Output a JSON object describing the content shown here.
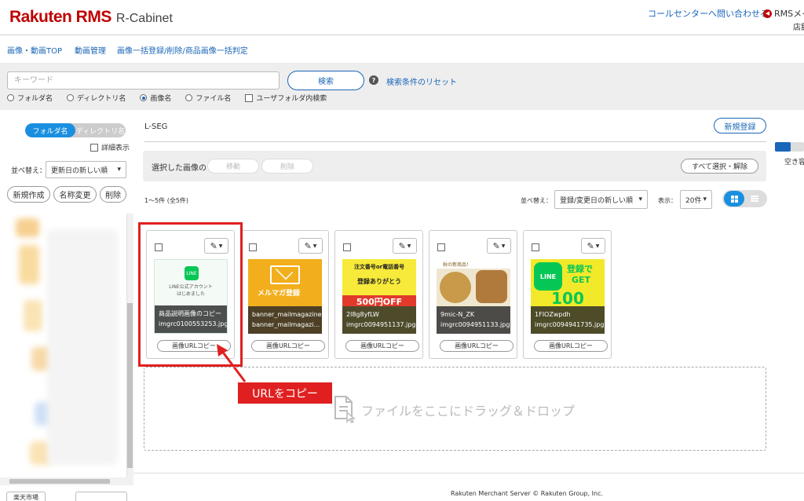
{
  "header": {
    "brand": "Rakuten RMS",
    "product": "R-Cabinet",
    "callcenter_link": "コールセンターへ問い合わせる",
    "rms_link": "RMSメイ",
    "store_label": "店舗"
  },
  "nav": [
    "画像・動画TOP",
    "動画管理",
    "画像一括登録/削除/商品画像一括判定"
  ],
  "search": {
    "placeholder": "キーワード",
    "button": "検索",
    "reset": "検索条件のリセット",
    "options": [
      {
        "label": "フォルダ名",
        "type": "radio",
        "checked": false
      },
      {
        "label": "ディレクトリ名",
        "type": "radio",
        "checked": false
      },
      {
        "label": "画像名",
        "type": "radio",
        "checked": true
      },
      {
        "label": "ファイル名",
        "type": "radio",
        "checked": false
      },
      {
        "label": "ユーザフォルダ内検索",
        "type": "checkbox",
        "checked": false
      }
    ]
  },
  "sidebar": {
    "toggle": [
      "フォルダ名",
      "ディレクトリ名"
    ],
    "detail": "詳細表示",
    "sort_label": "並べ替え：",
    "sort_value": "更新日の新しい順",
    "buttons": [
      "新規作成",
      "名称変更",
      "削除"
    ],
    "bottom": [
      "楽天市場",
      ""
    ]
  },
  "main": {
    "folder_name": "L-SEG",
    "new_button": "新規登録",
    "selected_label": "選択した画像の",
    "move": "移動",
    "delete": "削除",
    "select_all": "すべて選択・解除",
    "count": "1〜5件 (全5件)",
    "sort_label": "並べ替え：",
    "sort_value": "登録/変更日の新しい順",
    "view_label": "表示：",
    "view_value": "20件",
    "copy_label": "画像URLコピー",
    "drop_text": "ファイルをここにドラッグ＆ドロップ",
    "callout": "URLをコピー"
  },
  "cards": [
    {
      "name": "商品説明画像のコピー",
      "file": "imgrc0100553253.jpg",
      "thumb_text": [
        "LINE公式アカウント",
        "はじめました"
      ]
    },
    {
      "name": "banner_mailmagazine",
      "file": "banner_mailmagazi...",
      "thumb_text": [
        "メルマガ登録"
      ]
    },
    {
      "name": "2l8g8yfLW",
      "file": "imgrc0094951137.jpg",
      "thumb_text": [
        "注文番号or電話番号",
        "登録ありがとう",
        "500円OFF"
      ]
    },
    {
      "name": "9mic-N_ZK",
      "file": "imgrc0094951133.jpg",
      "thumb_text": [
        "秋の新商品！"
      ]
    },
    {
      "name": "1FIOZwpdh",
      "file": "imgrc0094941735.jpg",
      "thumb_text": [
        "LINE",
        "登録で",
        "GET",
        "100"
      ]
    }
  ],
  "colors": {
    "brand_red": "#bf0000",
    "link_blue": "#1a66b8",
    "toggle_blue": "#1a8fe0",
    "line_green": "#06c755",
    "highlight_red": "#e02020"
  },
  "right": {
    "capacity_label": "空き容"
  },
  "footer": "Rakuten Merchant Server © Rakuten Group, Inc."
}
